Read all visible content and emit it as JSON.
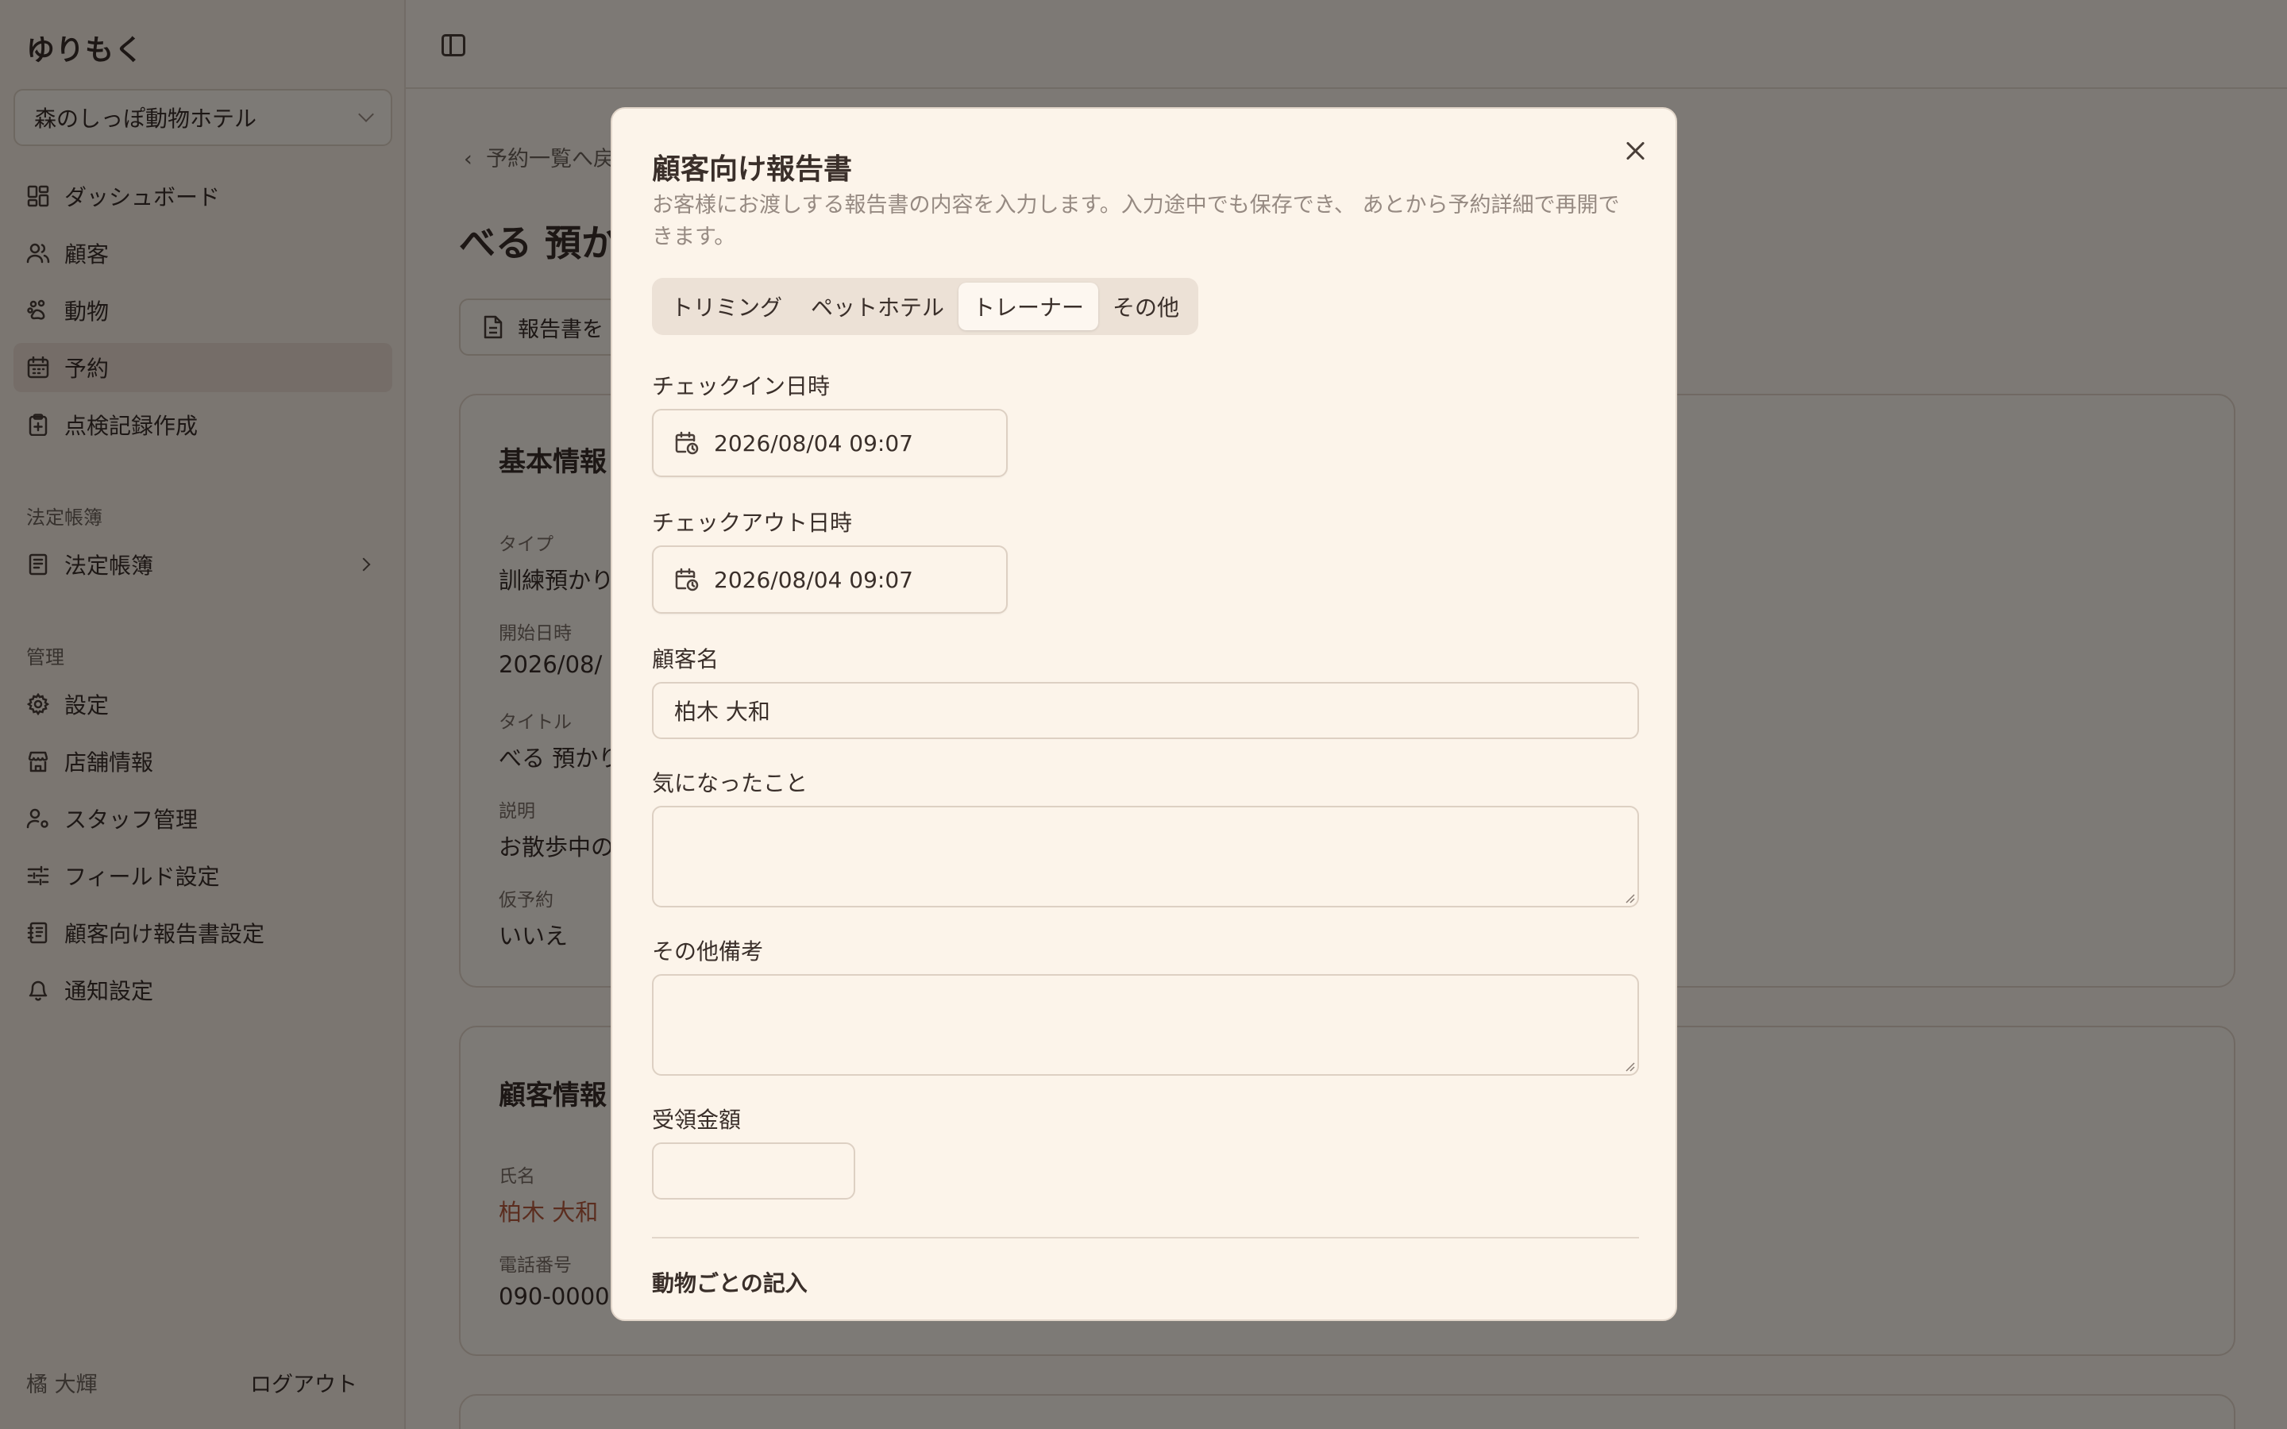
{
  "app": {
    "brand": "ゆりもく",
    "store": "森のしっぽ動物ホテル"
  },
  "sidebar": {
    "items": [
      {
        "label": "ダッシュボード"
      },
      {
        "label": "顧客"
      },
      {
        "label": "動物"
      },
      {
        "label": "予約"
      },
      {
        "label": "点検記録作成"
      }
    ],
    "section_ledger": "法定帳簿",
    "ledger_item": "法定帳簿",
    "section_admin": "管理",
    "admin_items": [
      {
        "label": "設定"
      },
      {
        "label": "店舗情報"
      },
      {
        "label": "スタッフ管理"
      },
      {
        "label": "フィールド設定"
      },
      {
        "label": "顧客向け報告書設定"
      },
      {
        "label": "通知設定"
      }
    ],
    "user": "橘 大輝",
    "logout": "ログアウト"
  },
  "main": {
    "back": "予約一覧へ戻",
    "title": "べる 預か",
    "report_button": "報告書を",
    "basic_card": {
      "title": "基本情報",
      "type_label": "タイプ",
      "type_value": "訓練預かり",
      "start_label": "開始日時",
      "start_value": "2026/08/",
      "title_label": "タイトル",
      "title_value": "べる 預かり",
      "desc_label": "説明",
      "desc_value": "お散歩中の",
      "tentative_label": "仮予約",
      "tentative_value": "いいえ"
    },
    "customer_card": {
      "title": "顧客情報",
      "name_label": "氏名",
      "name_value": "柏木 大和",
      "phone_label": "電話番号",
      "phone_value": "090-0000"
    }
  },
  "modal": {
    "title": "顧客向け報告書",
    "description": "お客様にお渡しする報告書の内容を入力します。入力途中でも保存でき、 あとから予約詳細で再開できます。",
    "tabs": [
      "トリミング",
      "ペットホテル",
      "トレーナー",
      "その他"
    ],
    "active_tab": "トレーナー",
    "checkin_label": "チェックイン日時",
    "checkin_value": "2026/08/04 09:07",
    "checkout_label": "チェックアウト日時",
    "checkout_value": "2026/08/04 09:07",
    "customer_label": "顧客名",
    "customer_value": "柏木 大和",
    "concern_label": "気になったこと",
    "notes_label": "その他備考",
    "amount_label": "受領金額",
    "per_animal_heading": "動物ごとの記入"
  }
}
